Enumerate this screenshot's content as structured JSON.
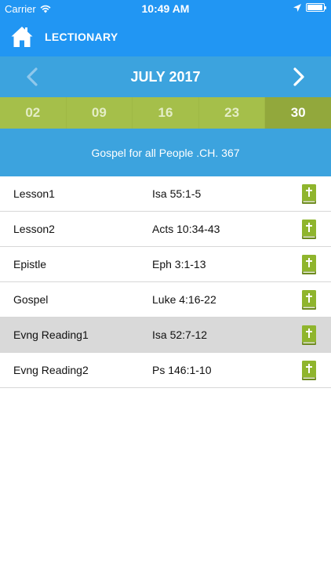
{
  "status_bar": {
    "carrier": "Carrier",
    "time": "10:49 AM"
  },
  "header": {
    "title": "LECTIONARY"
  },
  "month_nav": {
    "label": "JULY 2017"
  },
  "dates": [
    "02",
    "09",
    "16",
    "23",
    "30"
  ],
  "selected_date": "30",
  "hymn": {
    "text": "Gospel for all People .CH. 367"
  },
  "readings": [
    {
      "label": "Lesson1",
      "ref": "Isa 55:1-5"
    },
    {
      "label": "Lesson2",
      "ref": "Acts 10:34-43"
    },
    {
      "label": "Epistle",
      "ref": "Eph 3:1-13"
    },
    {
      "label": "Gospel",
      "ref": "Luke 4:16-22"
    },
    {
      "label": "Evng Reading1",
      "ref": "Isa 52:7-12"
    },
    {
      "label": "Evng Reading2",
      "ref": "Ps 146:1-10"
    }
  ],
  "highlighted_reading": "Evng Reading1",
  "colors": {
    "primary_blue": "#2196f3",
    "secondary_blue": "#3ca3de",
    "date_green": "#a5bf4a",
    "selected_date_green": "#92a83c",
    "bible_icon_green": "#8fb52d"
  }
}
